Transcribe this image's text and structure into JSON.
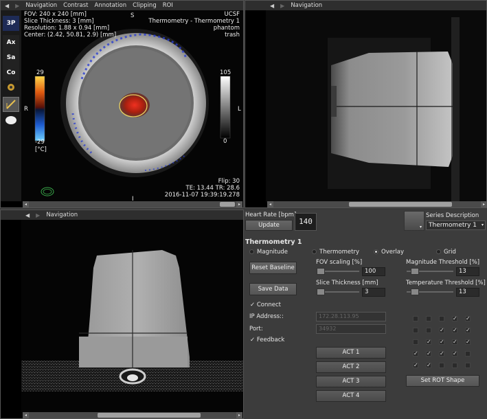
{
  "menu": {
    "back_arrow": "◀",
    "fwd_arrow": "▶",
    "items": [
      "Navigation",
      "Contrast",
      "Annotation",
      "Clipping",
      "ROI"
    ],
    "navigation": "Navigation"
  },
  "tools": [
    "3P",
    "Ax",
    "Sa",
    "Co",
    "",
    "",
    ""
  ],
  "axial": {
    "info_left": [
      "FOV: 240 x 240 [mm]",
      "Slice Thickness: 3 [mm]",
      "Resolution: 1.88 x 0.94 [mm]",
      "Center: (2.42, 50.81, 2.9) [mm]"
    ],
    "orient_top": "S",
    "orient_bottom": "I",
    "orient_left": "R",
    "orient_right": "L",
    "info_right": [
      "UCSF",
      "Thermometry - Thermometry 1",
      "phantom",
      "trash"
    ],
    "colorbar_max": "29",
    "colorbar_min": "-29",
    "colorbar_unit": "[°C]",
    "graybar_max": "105",
    "graybar_min": "0",
    "bottom_right": [
      "Flip: 30",
      "TE: 13.44  TR: 28.6",
      "2016-11-07   19:39:19.278"
    ]
  },
  "controls": {
    "heart_rate_label": "Heart Rate [bpm]",
    "update_button": "Update",
    "heart_rate_value": "140",
    "series_description_label": "Series Description",
    "series_selected": "Thermometry 1",
    "section_title": "Thermometry 1",
    "radios": [
      "Magnitude",
      "Thermometry",
      "Overlay",
      "Grid"
    ],
    "reset_baseline": "Reset Baseline",
    "save_data": "Save Data",
    "connect": "Connect",
    "ip_label": "IP Address::",
    "ip_value": "172.28.113.95",
    "port_label": "Port:",
    "port_value": "34932",
    "feedback": "Feedback",
    "fov_label": "FOV scaling [%]",
    "fov_value": "100",
    "slice_label": "Slice Thickness [mm]",
    "slice_value": "3",
    "mag_label": "Magnitude Threshold [%]",
    "mag_value": "13",
    "temp_label": "Temperature Threshold [%]",
    "temp_value": "13",
    "act_buttons": [
      "ACT 1",
      "ACT 2",
      "ACT 3",
      "ACT 4"
    ],
    "set_rot_shape": "Set ROT Shape",
    "check_mark": "✓",
    "grid": [
      [
        0,
        0,
        0,
        1,
        1
      ],
      [
        0,
        0,
        1,
        1,
        1
      ],
      [
        0,
        1,
        1,
        1,
        1
      ],
      [
        1,
        1,
        1,
        1,
        0
      ],
      [
        1,
        1,
        0,
        0,
        0
      ]
    ]
  },
  "colors": {
    "accent_yellow": "#e8d060",
    "heat_red": "#c0281a",
    "overlay_blue": "#2a3fd0"
  }
}
